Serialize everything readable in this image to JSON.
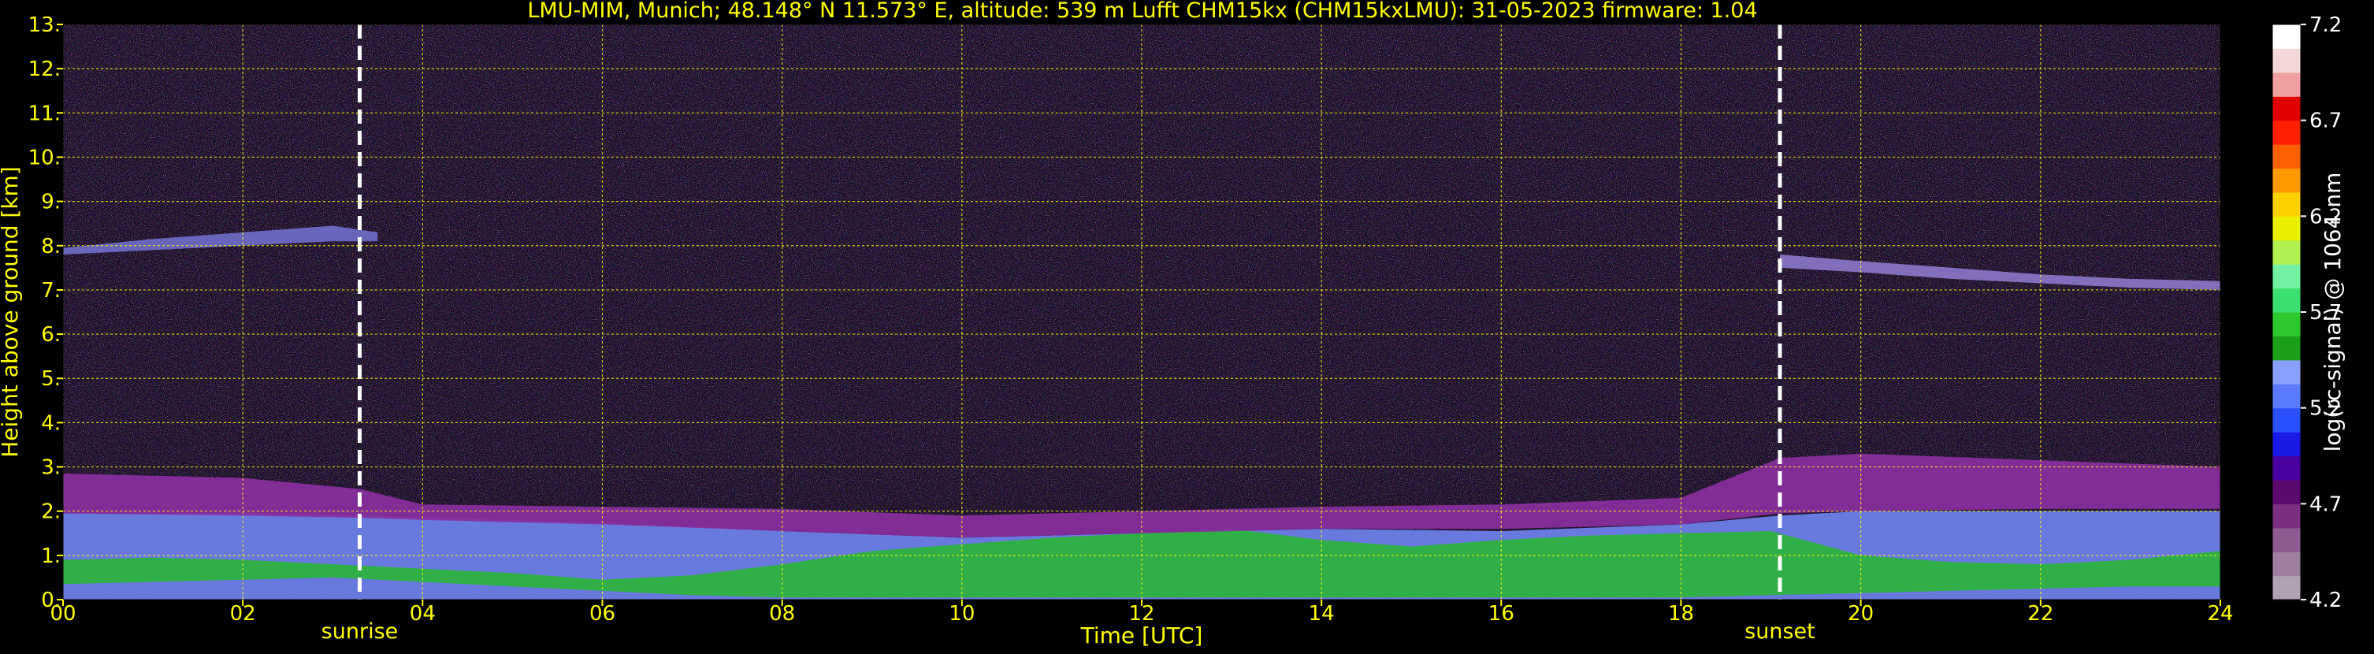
{
  "title": "LMU-MIM, Munich; 48.148° N 11.573° E, altitude: 539 m    Lufft CHM15kx (CHM15kxLMU): 31-05-2023    firmware: 1.04",
  "colors": {
    "background": "#000000",
    "text": "#ffff00",
    "grid": "#ffff00",
    "event_line": "#ffffff",
    "colorbar_label": "#ffffff"
  },
  "chart_data": {
    "type": "heatmap",
    "xlabel": "Time [UTC]",
    "ylabel": "Height above ground [km]",
    "xlim": [
      0,
      24
    ],
    "ylim": [
      0,
      13
    ],
    "x_ticks": [
      "00",
      "02",
      "04",
      "06",
      "08",
      "10",
      "12",
      "14",
      "16",
      "18",
      "20",
      "22",
      "24"
    ],
    "y_ticks": [
      "0.",
      "1.",
      "2.",
      "3.",
      "4.",
      "5.",
      "6.",
      "7.",
      "8.",
      "9.",
      "10.",
      "11.",
      "12.",
      "13."
    ],
    "grid": true,
    "events": [
      {
        "label": "sunrise",
        "time": 3.3
      },
      {
        "label": "sunset",
        "time": 19.1
      }
    ],
    "colorbar": {
      "label": "log(rc-signal) @ 1064 nm",
      "range": [
        4.2,
        7.2
      ],
      "ticks": [
        "4.2",
        "4.7",
        "5.2",
        "5.7",
        "6.2",
        "6.7",
        "7.2"
      ],
      "colors": [
        "#b2a0b4",
        "#9e7fa0",
        "#8e5a90",
        "#7a2f80",
        "#5a0a6e",
        "#4a00a0",
        "#1a1ae6",
        "#2a50ff",
        "#5a7aff",
        "#8aa0ff",
        "#1aa01a",
        "#2ec82e",
        "#3ae070",
        "#70f0a0",
        "#b0f050",
        "#e8f000",
        "#ffd000",
        "#ff9a00",
        "#ff6000",
        "#ff2000",
        "#e00000",
        "#f0a0a0",
        "#f4d8d8",
        "#ffffff"
      ]
    },
    "layers": [
      {
        "name": "boundary-layer",
        "t": [
          0,
          2,
          3.3,
          5,
          7,
          8,
          10,
          12,
          14,
          16,
          18,
          19.1,
          20,
          22,
          24
        ],
        "base": [
          0,
          0,
          0,
          0,
          0,
          0,
          0,
          0,
          0,
          0,
          0,
          0,
          0,
          0,
          0
        ],
        "top": [
          1.95,
          1.95,
          1.9,
          1.8,
          1.65,
          1.55,
          1.4,
          1.5,
          1.6,
          1.55,
          1.7,
          1.9,
          2.0,
          2.0,
          2.0
        ],
        "color": "#6f82ee"
      },
      {
        "name": "aerosol-green",
        "t": [
          0,
          1,
          2,
          3,
          4,
          5,
          6,
          7,
          8,
          9,
          10,
          11,
          12,
          13,
          14,
          15,
          16,
          17,
          18,
          19,
          20,
          21,
          22,
          23,
          24
        ],
        "base": [
          0.35,
          0.4,
          0.45,
          0.5,
          0.4,
          0.3,
          0.2,
          0.1,
          0.05,
          0.05,
          0.05,
          0.05,
          0.05,
          0.05,
          0.05,
          0.05,
          0.05,
          0.05,
          0.05,
          0.1,
          0.15,
          0.2,
          0.25,
          0.3,
          0.3
        ],
        "top": [
          0.9,
          0.95,
          0.9,
          0.8,
          0.7,
          0.6,
          0.45,
          0.55,
          0.8,
          1.1,
          1.25,
          1.4,
          1.5,
          1.6,
          1.35,
          1.2,
          1.35,
          1.45,
          1.5,
          1.55,
          1.0,
          0.85,
          0.8,
          0.9,
          1.1
        ],
        "color": "#2bb33a"
      },
      {
        "name": "residual-layer",
        "t": [
          0,
          2,
          3.3,
          4,
          6,
          8,
          10,
          12,
          14,
          16,
          18,
          19.1,
          20,
          22,
          24
        ],
        "base": [
          1.95,
          1.9,
          1.85,
          1.8,
          1.7,
          1.55,
          1.4,
          1.5,
          1.6,
          1.6,
          1.7,
          1.95,
          2.0,
          2.05,
          2.05
        ],
        "top": [
          2.85,
          2.75,
          2.5,
          2.15,
          2.1,
          2.05,
          1.9,
          2.0,
          2.1,
          2.15,
          2.3,
          3.2,
          3.3,
          3.15,
          3.0
        ],
        "color": "#8a2fa0"
      },
      {
        "name": "cirrus",
        "t": [
          0,
          1,
          2,
          3,
          3.5
        ],
        "base": [
          7.8,
          7.9,
          8.0,
          8.1,
          8.1
        ],
        "top": [
          7.95,
          8.15,
          8.3,
          8.45,
          8.3
        ],
        "color": "#6e6cc8"
      },
      {
        "name": "cirrus",
        "t": [
          19.1,
          20,
          21,
          22,
          23,
          24
        ],
        "base": [
          7.5,
          7.4,
          7.25,
          7.15,
          7.05,
          7.0
        ],
        "top": [
          7.8,
          7.65,
          7.5,
          7.35,
          7.25,
          7.2
        ],
        "color": "#8a76c8"
      }
    ]
  }
}
